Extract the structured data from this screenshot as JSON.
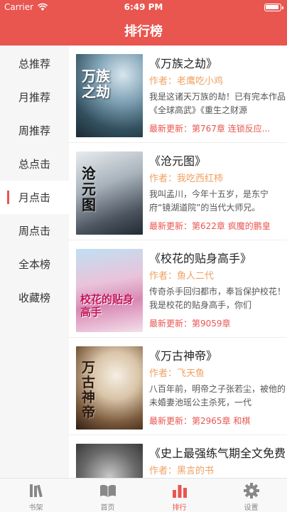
{
  "status": {
    "carrier": "Carrier",
    "time": "6:49 PM"
  },
  "nav": {
    "title": "排行榜"
  },
  "sidebar": {
    "items": [
      {
        "label": "总推荐"
      },
      {
        "label": "月推荐"
      },
      {
        "label": "周推荐"
      },
      {
        "label": "总点击"
      },
      {
        "label": "月点击",
        "active": true
      },
      {
        "label": "周点击"
      },
      {
        "label": "全本榜"
      },
      {
        "label": "收藏榜"
      }
    ]
  },
  "books": [
    {
      "title": "《万族之劫》",
      "author_label": "作者：",
      "author": "老鹰吃小鸡",
      "desc": "我是这诸天万族的劫！已有完本作品《全球高武》《重生之财源",
      "latest_label": "最新更新：",
      "latest": "第767章 连锁反应...",
      "cover_text": "万族之劫"
    },
    {
      "title": "《沧元图》",
      "author_label": "作者：",
      "author": "我吃西红柿",
      "desc": "我叫孟川，今年十五岁，是东宁府“镜湖道院”的当代大师兄。",
      "latest_label": "最新更新：",
      "latest": "第622章 疯魔的鹏皇",
      "cover_text": "沧元图"
    },
    {
      "title": "《校花的贴身高手》",
      "author_label": "作者：",
      "author": "鱼人二代",
      "desc": "传奇杀手回归都市，奉旨保护校花！我是校花的贴身高手，你们",
      "latest_label": "最新更新：",
      "latest": "第9059章",
      "cover_text": "校花的贴身高手"
    },
    {
      "title": "《万古神帝》",
      "author_label": "作者：",
      "author": "飞天鱼",
      "desc": "八百年前，明帝之子张若尘，被他的未婚妻池瑶公主杀死，一代",
      "latest_label": "最新更新：",
      "latest": "第2965章 和棋",
      "cover_text": "万古神帝"
    },
    {
      "title": "《史上最强练气期全文免费阅读》",
      "author_label": "作者：",
      "author": "黑言的书",
      "desc": "",
      "latest_label": "",
      "latest": "",
      "cover_text": ""
    }
  ],
  "tabs": [
    {
      "label": "书架",
      "icon": "bookshelf-icon"
    },
    {
      "label": "首页",
      "icon": "open-book-icon"
    },
    {
      "label": "排行",
      "icon": "ranking-icon",
      "active": true
    },
    {
      "label": "设置",
      "icon": "gear-icon"
    }
  ],
  "colors": {
    "accent": "#e9554f",
    "author": "#f0a060",
    "sidebar_bg": "#f6f6f6"
  }
}
